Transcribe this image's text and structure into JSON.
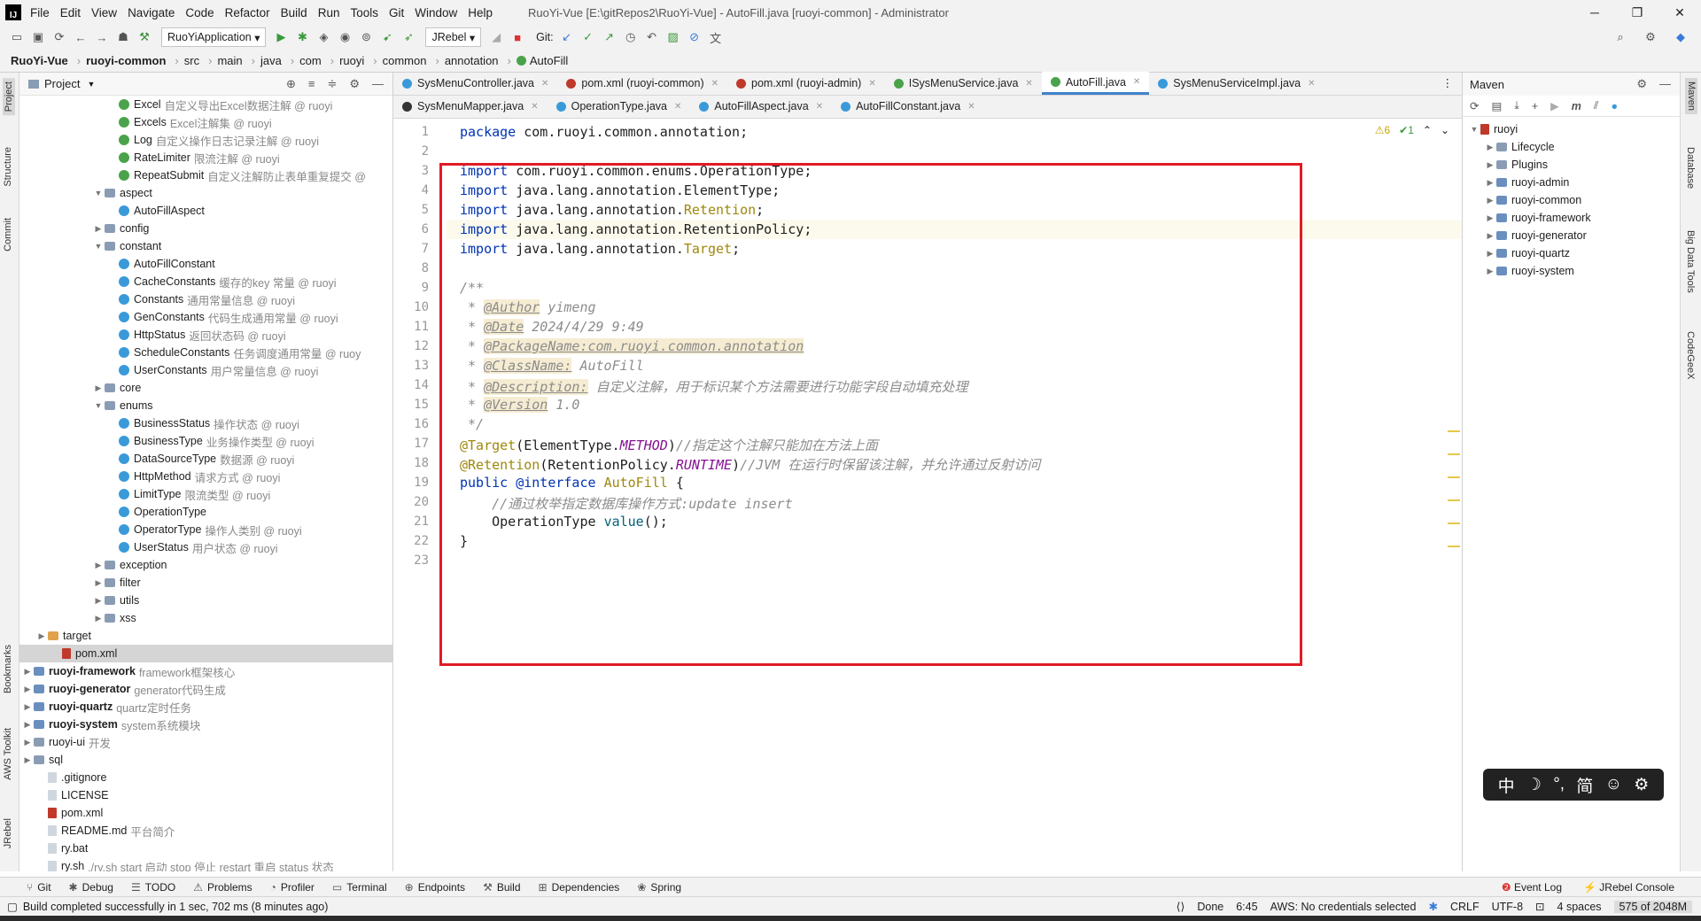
{
  "window": {
    "title": "RuoYi-Vue [E:\\gitRepos2\\RuoYi-Vue] - AutoFill.java [ruoyi-common] - Administrator",
    "logo": "IJ",
    "controls": [
      "─",
      "❐",
      "✕"
    ]
  },
  "menu": [
    "File",
    "Edit",
    "View",
    "Navigate",
    "Code",
    "Refactor",
    "Build",
    "Run",
    "Tools",
    "Git",
    "Window",
    "Help"
  ],
  "toolbar": {
    "run_config": "RuoYiApplication",
    "jrebel": "JRebel",
    "git_label": "Git:"
  },
  "breadcrumb": [
    "RuoYi-Vue",
    "ruoyi-common",
    "src",
    "main",
    "java",
    "com",
    "ruoyi",
    "common",
    "annotation",
    "AutoFill"
  ],
  "left_strip": {
    "project": "Project",
    "structure": "Structure",
    "commit": "Commit",
    "bookmarks": "Bookmarks",
    "aws": "AWS Toolkit",
    "jrebel": "JRebel"
  },
  "project_panel": {
    "title": "Project"
  },
  "tree": [
    {
      "label": "Excel",
      "desc": "自定义导出Excel数据注解 @ ruoyi",
      "icon": "ann",
      "indent": 8
    },
    {
      "label": "Excels",
      "desc": "Excel注解集 @ ruoyi",
      "icon": "ann",
      "indent": 8
    },
    {
      "label": "Log",
      "desc": "自定义操作日志记录注解 @ ruoyi",
      "icon": "ann",
      "indent": 8
    },
    {
      "label": "RateLimiter",
      "desc": "限流注解 @ ruoyi",
      "icon": "ann",
      "indent": 8
    },
    {
      "label": "RepeatSubmit",
      "desc": "自定义注解防止表单重复提交 @",
      "icon": "ann",
      "indent": 8
    },
    {
      "label": "aspect",
      "desc": "",
      "icon": "folder",
      "indent": 7,
      "arrow": "▼"
    },
    {
      "label": "AutoFillAspect",
      "desc": "",
      "icon": "cls",
      "indent": 8
    },
    {
      "label": "config",
      "desc": "",
      "icon": "folder",
      "indent": 7,
      "arrow": "▶"
    },
    {
      "label": "constant",
      "desc": "",
      "icon": "folder",
      "indent": 7,
      "arrow": "▼"
    },
    {
      "label": "AutoFillConstant",
      "desc": "",
      "icon": "cls",
      "indent": 8
    },
    {
      "label": "CacheConstants",
      "desc": "缓存的key 常量 @ ruoyi",
      "icon": "cls",
      "indent": 8
    },
    {
      "label": "Constants",
      "desc": "通用常量信息 @ ruoyi",
      "icon": "cls",
      "indent": 8
    },
    {
      "label": "GenConstants",
      "desc": "代码生成通用常量 @ ruoyi",
      "icon": "cls",
      "indent": 8
    },
    {
      "label": "HttpStatus",
      "desc": "返回状态码 @ ruoyi",
      "icon": "cls",
      "indent": 8
    },
    {
      "label": "ScheduleConstants",
      "desc": "任务调度通用常量 @ ruoy",
      "icon": "cls",
      "indent": 8
    },
    {
      "label": "UserConstants",
      "desc": "用户常量信息 @ ruoyi",
      "icon": "cls",
      "indent": 8
    },
    {
      "label": "core",
      "desc": "",
      "icon": "folder",
      "indent": 7,
      "arrow": "▶"
    },
    {
      "label": "enums",
      "desc": "",
      "icon": "folder",
      "indent": 7,
      "arrow": "▼"
    },
    {
      "label": "BusinessStatus",
      "desc": "操作状态 @ ruoyi",
      "icon": "cls",
      "indent": 8
    },
    {
      "label": "BusinessType",
      "desc": "业务操作类型 @ ruoyi",
      "icon": "cls",
      "indent": 8
    },
    {
      "label": "DataSourceType",
      "desc": "数据源 @ ruoyi",
      "icon": "cls",
      "indent": 8
    },
    {
      "label": "HttpMethod",
      "desc": "请求方式 @ ruoyi",
      "icon": "cls",
      "indent": 8
    },
    {
      "label": "LimitType",
      "desc": "限流类型 @ ruoyi",
      "icon": "cls",
      "indent": 8
    },
    {
      "label": "OperationType",
      "desc": "",
      "icon": "cls",
      "indent": 8
    },
    {
      "label": "OperatorType",
      "desc": "操作人类别 @ ruoyi",
      "icon": "cls",
      "indent": 8
    },
    {
      "label": "UserStatus",
      "desc": "用户状态 @ ruoyi",
      "icon": "cls",
      "indent": 8
    },
    {
      "label": "exception",
      "desc": "",
      "icon": "folder",
      "indent": 7,
      "arrow": "▶"
    },
    {
      "label": "filter",
      "desc": "",
      "icon": "folder",
      "indent": 7,
      "arrow": "▶"
    },
    {
      "label": "utils",
      "desc": "",
      "icon": "folder",
      "indent": 7,
      "arrow": "▶"
    },
    {
      "label": "xss",
      "desc": "",
      "icon": "folder",
      "indent": 7,
      "arrow": "▶"
    },
    {
      "label": "target",
      "desc": "",
      "icon": "fold-or",
      "indent": 3,
      "arrow": "▶"
    },
    {
      "label": "pom.xml",
      "desc": "",
      "icon": "mvn",
      "indent": 4,
      "selected": true
    },
    {
      "label": "ruoyi-framework",
      "desc": "framework框架核心",
      "icon": "mod",
      "indent": 2,
      "arrow": "▶",
      "bold": true
    },
    {
      "label": "ruoyi-generator",
      "desc": "generator代码生成",
      "icon": "mod",
      "indent": 2,
      "arrow": "▶",
      "bold": true
    },
    {
      "label": "ruoyi-quartz",
      "desc": "quartz定时任务",
      "icon": "mod",
      "indent": 2,
      "arrow": "▶",
      "bold": true
    },
    {
      "label": "ruoyi-system",
      "desc": "system系统模块",
      "icon": "mod",
      "indent": 2,
      "arrow": "▶",
      "bold": true
    },
    {
      "label": "ruoyi-ui",
      "desc": "开发",
      "icon": "folder",
      "indent": 2,
      "arrow": "▶"
    },
    {
      "label": "sql",
      "desc": "",
      "icon": "folder",
      "indent": 2,
      "arrow": "▶"
    },
    {
      "label": ".gitignore",
      "desc": "",
      "icon": "file",
      "indent": 3
    },
    {
      "label": "LICENSE",
      "desc": "",
      "icon": "file",
      "indent": 3
    },
    {
      "label": "pom.xml",
      "desc": "",
      "icon": "mvn",
      "indent": 3
    },
    {
      "label": "README.md",
      "desc": "平台简介",
      "icon": "file",
      "indent": 3
    },
    {
      "label": "ry.bat",
      "desc": "",
      "icon": "file",
      "indent": 3
    },
    {
      "label": "ry.sh",
      "desc": "./ry.sh start 启动 stop 停止 restart 重启 status 状态",
      "icon": "file",
      "indent": 3
    }
  ],
  "tabs_row1": [
    {
      "label": "SysMenuController.java",
      "color": "#3a9ad9"
    },
    {
      "label": "pom.xml (ruoyi-common)",
      "color": "#c0392b"
    },
    {
      "label": "pom.xml (ruoyi-admin)",
      "color": "#c0392b"
    },
    {
      "label": "ISysMenuService.java",
      "color": "#4aa34a"
    },
    {
      "label": "AutoFill.java",
      "color": "#4aa34a",
      "active": true
    },
    {
      "label": "SysMenuServiceImpl.java",
      "color": "#3a9ad9"
    }
  ],
  "tabs_row2": [
    {
      "label": "SysMenuMapper.java",
      "color": "#333"
    },
    {
      "label": "OperationType.java",
      "color": "#3a9ad9"
    },
    {
      "label": "AutoFillAspect.java",
      "color": "#3a9ad9"
    },
    {
      "label": "AutoFillConstant.java",
      "color": "#3a9ad9"
    }
  ],
  "inspection": {
    "warnings": "⚠6",
    "ok": "✔1"
  },
  "code_lines": [
    "<span class=\"kw\">package</span> com.ruoyi.common.annotation;",
    "",
    "<span class=\"kw\">import</span> com.ruoyi.common.enums.OperationType;",
    "<span class=\"kw\">import</span> java.lang.annotation.ElementType;",
    "<span class=\"kw\">import</span> java.lang.annotation.<span class=\"ann\">Retention</span>;",
    "<span class=\"kw\">import</span> java.lang.annotation.RetentionPolicy;",
    "<span class=\"kw\">import</span> java.lang.annotation.<span class=\"ann\">Target</span>;",
    "",
    "<span class=\"cm\">/**</span>",
    "<span class=\"cm\"> * </span><span class=\"tag\">@Author</span><span class=\"cm\"> yimeng</span>",
    "<span class=\"cm\"> * </span><span class=\"tag\">@Date</span><span class=\"cm\"> 2024/4/29 9:49</span>",
    "<span class=\"cm\"> * </span><span class=\"tag\">@PackageName:com.ruoyi.common.annotation</span>",
    "<span class=\"cm\"> * </span><span class=\"tag\">@ClassName:</span><span class=\"cm\"> AutoFill</span>",
    "<span class=\"cm\"> * </span><span class=\"tag\">@Description:</span><span class=\"cm\"> 自定义注解，用于标识某个方法需要进行功能字段自动填充处理</span>",
    "<span class=\"cm\"> * </span><span class=\"tag\">@Version</span><span class=\"cm\"> 1.0</span>",
    "<span class=\"cm\"> */</span>",
    "<span class=\"ann\">@Target</span>(ElementType.<span class=\"fld\">METHOD</span>)<span class=\"cm\">//指定这个注解只能加在方法上面</span>",
    "<span class=\"ann\">@Retention</span>(RetentionPolicy.<span class=\"fld\">RUNTIME</span>)<span class=\"cm\">//JVM 在运行时保留该注解，并允许通过反射访问</span>",
    "<span class=\"kw\">public</span> <span class=\"kw\">@interface</span> <span class=\"ann\">AutoFill</span> {",
    "    <span class=\"cm\">//通过枚举指定数据库操作方式:update insert</span>",
    "    OperationType <span class=\"meth\">value</span>();",
    "}",
    ""
  ],
  "maven": {
    "title": "Maven",
    "root": "ruoyi",
    "items": [
      "Lifecycle",
      "Plugins",
      "ruoyi-admin",
      "ruoyi-common",
      "ruoyi-framework",
      "ruoyi-generator",
      "ruoyi-quartz",
      "ruoyi-system"
    ]
  },
  "right_strip": {
    "maven": "Maven",
    "database": "Database",
    "bigdata": "Big Data Tools",
    "codegeex": "CodeGeeX"
  },
  "bottom_tools": [
    "Git",
    "Debug",
    "TODO",
    "Problems",
    "Profiler",
    "Terminal",
    "Endpoints",
    "Build",
    "Dependencies",
    "Spring"
  ],
  "bottom_right": [
    "Event Log",
    "JRebel Console"
  ],
  "status": {
    "message": "Build completed successfully in 1 sec, 702 ms (8 minutes ago)",
    "done": "Done",
    "position": "6:45",
    "aws": "AWS: No credentials selected",
    "line_sep": "CRLF",
    "encoding": "UTF-8",
    "indent": "4 spaces",
    "memory": "575 of 2048M"
  },
  "ime": [
    "中",
    "☽",
    "°,",
    "简",
    "☺",
    "⚙"
  ]
}
